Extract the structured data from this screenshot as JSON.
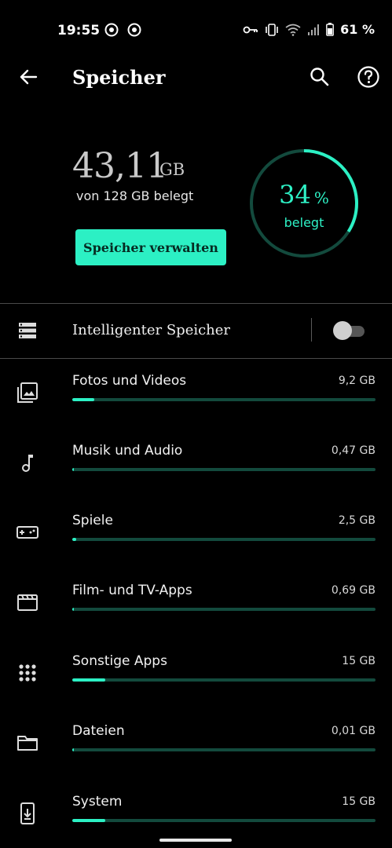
{
  "status_bar": {
    "time": "19:55",
    "battery": "61 %"
  },
  "app_bar": {
    "title": "Speicher"
  },
  "summary": {
    "used_value": "43,11",
    "used_unit": "GB",
    "used_of": "von 128 GB belegt",
    "manage_button": "Speicher verwalten",
    "percent_value": "34",
    "percent_symbol": "%",
    "percent_label": "belegt",
    "percent_fraction": 0.34
  },
  "smart_storage": {
    "label": "Intelligenter Speicher",
    "enabled": false
  },
  "categories": [
    {
      "label": "Fotos und Videos",
      "size": "9,2 GB",
      "icon": "photo-library-icon",
      "fraction": 0.072
    },
    {
      "label": "Musik und Audio",
      "size": "0,47 GB",
      "icon": "music-note-icon",
      "fraction": 0.0
    },
    {
      "label": "Spiele",
      "size": "2,5 GB",
      "icon": "gamepad-icon",
      "fraction": 0.012
    },
    {
      "label": "Film- und TV-Apps",
      "size": "0,69 GB",
      "icon": "movie-icon",
      "fraction": 0.0
    },
    {
      "label": "Sonstige Apps",
      "size": "15 GB",
      "icon": "apps-grid-icon",
      "fraction": 0.11
    },
    {
      "label": "Dateien",
      "size": "0,01 GB",
      "icon": "folder-icon",
      "fraction": 0.0
    },
    {
      "label": "System",
      "size": "15 GB",
      "icon": "system-update-icon",
      "fraction": 0.11
    }
  ],
  "colors": {
    "accent": "#2cf0c4",
    "track": "#134a3d",
    "background": "#000000"
  }
}
